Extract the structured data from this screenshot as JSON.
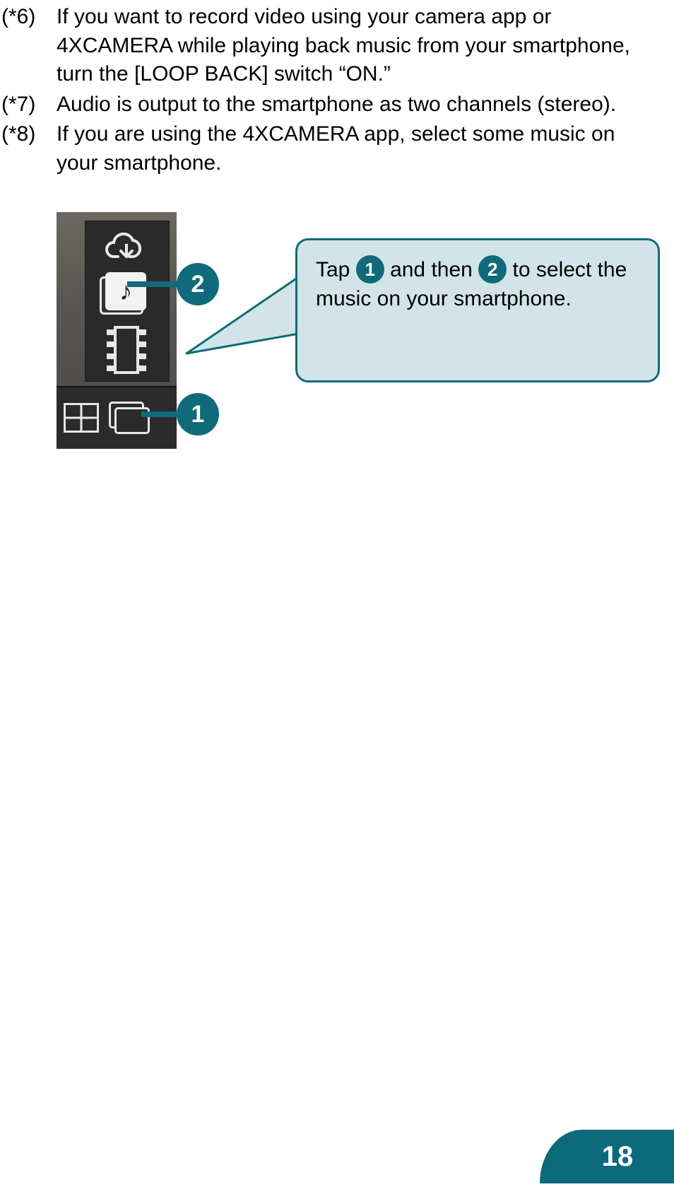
{
  "notes": [
    {
      "label": "(*6)",
      "text": "If you want to record video using your camera app or 4XCAMERA while playing back music from your smartphone, turn the [LOOP BACK] switch “ON.”"
    },
    {
      "label": "(*7)",
      "text": "Audio is output to the smartphone as two channels (stereo)."
    },
    {
      "label": "(*8)",
      "text": "If you are using the 4XCAMERA app, select some music on your smartphone."
    }
  ],
  "illustration": {
    "badge1": "1",
    "badge2": "2"
  },
  "callout": {
    "prefix": "Tap ",
    "badge_a": "1",
    "mid": " and then ",
    "badge_b": "2",
    "suffix": " to select the music on your smartphone."
  },
  "page_number": "18"
}
